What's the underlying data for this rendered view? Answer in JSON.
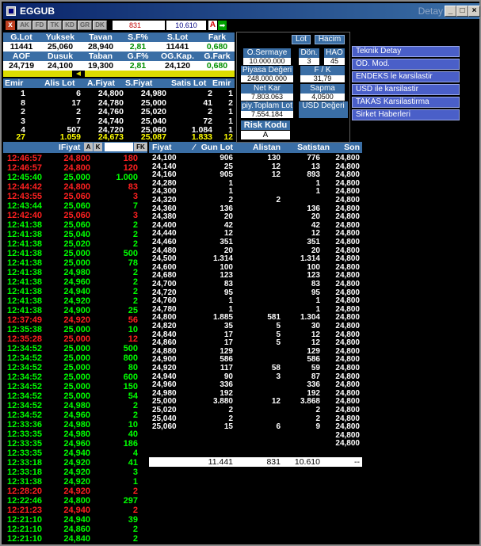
{
  "window": {
    "title": "EGGUB",
    "detail_label": "Detay"
  },
  "toolbar": {
    "close_label": "x",
    "buttons": [
      "AK",
      "FD",
      "TK",
      "KD",
      "GR",
      "DK"
    ],
    "value_left": "831",
    "value_right": "10.610",
    "a_label": "A",
    "arrow_label": "➡"
  },
  "summary": {
    "row1_headers": [
      "G.Lot",
      "Yuksek",
      "Tavan",
      "S.F%",
      "S.Lot",
      "Fark"
    ],
    "row1_values": [
      "11441",
      "25,060",
      "28,940",
      "2,81",
      "11441",
      "0,680"
    ],
    "row2_headers": [
      "AOF",
      "Dusuk",
      "Taban",
      "G.F%",
      "OG.Kap.",
      "G.Fark"
    ],
    "row2_values": [
      "24,719",
      "24,100",
      "19,300",
      "2,81",
      "24,120",
      "0,680"
    ]
  },
  "depth": {
    "headers": [
      "Emir",
      "Alis Lot",
      "A.Fiyat",
      "S.Fiyat",
      "Satis Lot",
      "Emir"
    ],
    "rows": [
      [
        "1",
        "6",
        "24,800",
        "24,980",
        "2",
        "1"
      ],
      [
        "8",
        "17",
        "24,780",
        "25,000",
        "41",
        "2"
      ],
      [
        "2",
        "2",
        "24,760",
        "25,020",
        "2",
        "1"
      ],
      [
        "3",
        "7",
        "24,740",
        "25,040",
        "72",
        "1"
      ],
      [
        "4",
        "507",
        "24,720",
        "25,060",
        "1.084",
        "1"
      ]
    ],
    "total": [
      "27",
      "1.059",
      "24,673",
      "25,087",
      "1.833",
      "12"
    ]
  },
  "trades": {
    "header_label": "IFiyat",
    "btn_a": "A",
    "btn_k": "K",
    "btn_fk": "FK",
    "rows": [
      {
        "time": "12:46:57",
        "price": "24,800",
        "lot": "180",
        "dir": "dn"
      },
      {
        "time": "12:46:57",
        "price": "24,800",
        "lot": "120",
        "dir": "dn"
      },
      {
        "time": "12:45:40",
        "price": "25,000",
        "lot": "1.000",
        "dir": "up"
      },
      {
        "time": "12:44:42",
        "price": "24,800",
        "lot": "83",
        "dir": "dn"
      },
      {
        "time": "12:43:55",
        "price": "25,060",
        "lot": "3",
        "dir": "dn"
      },
      {
        "time": "12:43:44",
        "price": "25,060",
        "lot": "7",
        "dir": "up"
      },
      {
        "time": "12:42:40",
        "price": "25,060",
        "lot": "3",
        "dir": "dn"
      },
      {
        "time": "12:41:38",
        "price": "25,060",
        "lot": "2",
        "dir": "up"
      },
      {
        "time": "12:41:38",
        "price": "25,040",
        "lot": "2",
        "dir": "up"
      },
      {
        "time": "12:41:38",
        "price": "25,020",
        "lot": "2",
        "dir": "up"
      },
      {
        "time": "12:41:38",
        "price": "25,000",
        "lot": "500",
        "dir": "up"
      },
      {
        "time": "12:41:38",
        "price": "25,000",
        "lot": "78",
        "dir": "up"
      },
      {
        "time": "12:41:38",
        "price": "24,980",
        "lot": "2",
        "dir": "up"
      },
      {
        "time": "12:41:38",
        "price": "24,960",
        "lot": "2",
        "dir": "up"
      },
      {
        "time": "12:41:38",
        "price": "24,940",
        "lot": "2",
        "dir": "up"
      },
      {
        "time": "12:41:38",
        "price": "24,920",
        "lot": "2",
        "dir": "up"
      },
      {
        "time": "12:41:38",
        "price": "24,900",
        "lot": "25",
        "dir": "up"
      },
      {
        "time": "12:37:49",
        "price": "24,920",
        "lot": "56",
        "dir": "dn"
      },
      {
        "time": "12:35:38",
        "price": "25,000",
        "lot": "10",
        "dir": "up"
      },
      {
        "time": "12:35:28",
        "price": "25,000",
        "lot": "12",
        "dir": "dn"
      },
      {
        "time": "12:34:52",
        "price": "25,000",
        "lot": "500",
        "dir": "up"
      },
      {
        "time": "12:34:52",
        "price": "25,000",
        "lot": "800",
        "dir": "up"
      },
      {
        "time": "12:34:52",
        "price": "25,000",
        "lot": "80",
        "dir": "up"
      },
      {
        "time": "12:34:52",
        "price": "25,000",
        "lot": "600",
        "dir": "up"
      },
      {
        "time": "12:34:52",
        "price": "25,000",
        "lot": "150",
        "dir": "up"
      },
      {
        "time": "12:34:52",
        "price": "25,000",
        "lot": "54",
        "dir": "up"
      },
      {
        "time": "12:34:52",
        "price": "24,980",
        "lot": "2",
        "dir": "up"
      },
      {
        "time": "12:34:52",
        "price": "24,960",
        "lot": "2",
        "dir": "up"
      },
      {
        "time": "12:33:36",
        "price": "24,980",
        "lot": "10",
        "dir": "up"
      },
      {
        "time": "12:33:35",
        "price": "24,980",
        "lot": "40",
        "dir": "up"
      },
      {
        "time": "12:33:35",
        "price": "24,960",
        "lot": "186",
        "dir": "up"
      },
      {
        "time": "12:33:35",
        "price": "24,940",
        "lot": "4",
        "dir": "up"
      },
      {
        "time": "12:33:18",
        "price": "24,920",
        "lot": "41",
        "dir": "up"
      },
      {
        "time": "12:33:18",
        "price": "24,920",
        "lot": "3",
        "dir": "up"
      },
      {
        "time": "12:31:38",
        "price": "24,920",
        "lot": "1",
        "dir": "up"
      },
      {
        "time": "12:28:20",
        "price": "24,920",
        "lot": "2",
        "dir": "dn"
      },
      {
        "time": "12:22:46",
        "price": "24,800",
        "lot": "297",
        "dir": "up"
      },
      {
        "time": "12:21:23",
        "price": "24,940",
        "lot": "2",
        "dir": "dn"
      },
      {
        "time": "12:21:10",
        "price": "24,940",
        "lot": "39",
        "dir": "up"
      },
      {
        "time": "12:21:10",
        "price": "24,860",
        "lot": "2",
        "dir": "up"
      },
      {
        "time": "12:21:10",
        "price": "24,840",
        "lot": "2",
        "dir": "up"
      }
    ]
  },
  "prices": {
    "headers": [
      "Fiyat",
      "Gun Lot",
      "Alistan",
      "Satistan",
      "Son"
    ],
    "rows": [
      [
        "24,100",
        "906",
        "130",
        "776",
        "24,800"
      ],
      [
        "24,140",
        "25",
        "12",
        "13",
        "24,800"
      ],
      [
        "24,160",
        "905",
        "12",
        "893",
        "24,800"
      ],
      [
        "24,280",
        "1",
        "",
        "1",
        "24,800"
      ],
      [
        "24,300",
        "1",
        "",
        "1",
        "24,800"
      ],
      [
        "24,320",
        "2",
        "2",
        "",
        "24,800"
      ],
      [
        "24,360",
        "136",
        "",
        "136",
        "24,800"
      ],
      [
        "24,380",
        "20",
        "",
        "20",
        "24,800"
      ],
      [
        "24,400",
        "42",
        "",
        "42",
        "24,800"
      ],
      [
        "24,440",
        "12",
        "",
        "12",
        "24,800"
      ],
      [
        "24,460",
        "351",
        "",
        "351",
        "24,800"
      ],
      [
        "24,480",
        "20",
        "",
        "20",
        "24,800"
      ],
      [
        "24,500",
        "1.314",
        "",
        "1.314",
        "24,800"
      ],
      [
        "24,600",
        "100",
        "",
        "100",
        "24,800"
      ],
      [
        "24,680",
        "123",
        "",
        "123",
        "24,800"
      ],
      [
        "24,700",
        "83",
        "",
        "83",
        "24,800"
      ],
      [
        "24,720",
        "95",
        "",
        "95",
        "24,800"
      ],
      [
        "24,760",
        "1",
        "",
        "1",
        "24,800"
      ],
      [
        "24,780",
        "1",
        "",
        "1",
        "24,800"
      ],
      [
        "24,800",
        "1.885",
        "581",
        "1.304",
        "24,800"
      ],
      [
        "24,820",
        "35",
        "5",
        "30",
        "24,800"
      ],
      [
        "24,840",
        "17",
        "5",
        "12",
        "24,800"
      ],
      [
        "24,860",
        "17",
        "5",
        "12",
        "24,800"
      ],
      [
        "24,880",
        "129",
        "",
        "129",
        "24,800"
      ],
      [
        "24,900",
        "586",
        "",
        "586",
        "24,800"
      ],
      [
        "24,920",
        "117",
        "58",
        "59",
        "24,800"
      ],
      [
        "24,940",
        "90",
        "3",
        "87",
        "24,800"
      ],
      [
        "24,960",
        "336",
        "",
        "336",
        "24,800"
      ],
      [
        "24,980",
        "192",
        "",
        "192",
        "24,800"
      ],
      [
        "25,000",
        "3.880",
        "12",
        "3.868",
        "24,800"
      ],
      [
        "25,020",
        "2",
        "",
        "2",
        "24,800"
      ],
      [
        "25,040",
        "2",
        "",
        "2",
        "24,800"
      ],
      [
        "25,060",
        "15",
        "6",
        "9",
        "24,800"
      ],
      [
        "",
        "",
        "",
        "",
        "24,800"
      ],
      [
        "",
        "",
        "",
        "",
        "24,800"
      ]
    ],
    "footer": [
      "11.441",
      "831",
      "10.610",
      "--"
    ]
  },
  "info_panel": {
    "lot_btn": "Lot",
    "hacim_btn": "Hacim",
    "osermaye_label": "O.Sermaye",
    "osermaye_value": "10.000.000",
    "don_label": "Dön.",
    "don_value": "3",
    "hao_label": "HAO",
    "hao_value": "45",
    "piyasa_label": "Piyasa Değeri",
    "piyasa_value": "248.000.000",
    "fk_label": "F / K",
    "fk_value": "31,79",
    "netkar_label": "Net Kar",
    "netkar_value": "7.803.063",
    "sapma_label": "Sapma",
    "sapma_value": "4,0500",
    "toplam_label": "piy.Toplam Lot",
    "toplam_value": "7.554.184",
    "usd_label": "USD Değeri",
    "risk_label": "Risk Kodu",
    "risk_value": "A"
  },
  "menu": {
    "items": [
      "Teknik Detay",
      "OD. Mod.",
      "ENDEKS le karsilastir",
      "USD ile karsilastir",
      "TAKAS Karsilastirma",
      "Sirket Haberleri"
    ]
  },
  "colors": {
    "header_blue": "#3a6ea5",
    "menu_blue": "#4a5fc8",
    "up_green": "#00ff00",
    "down_red": "#ff2020",
    "total_yellow": "#ffff00"
  }
}
